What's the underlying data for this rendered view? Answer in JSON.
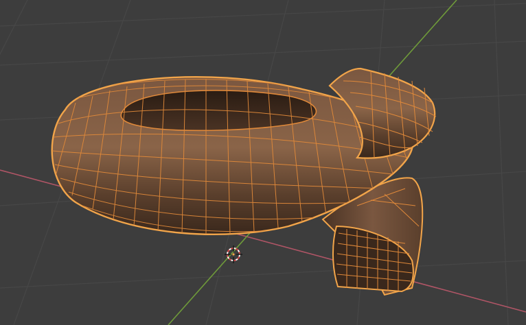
{
  "viewport": {
    "background": "#3d3d3d",
    "grid_color": "#474747",
    "x_axis_color": "#b05566",
    "y_axis_color": "#6f9b3a",
    "mesh_fill": "#6b4a34",
    "mesh_shadow": "#3a281c",
    "wire_color": "#e0893a",
    "outline_color": "#f2a54a",
    "object_icon": "3d-cursor-icon"
  }
}
